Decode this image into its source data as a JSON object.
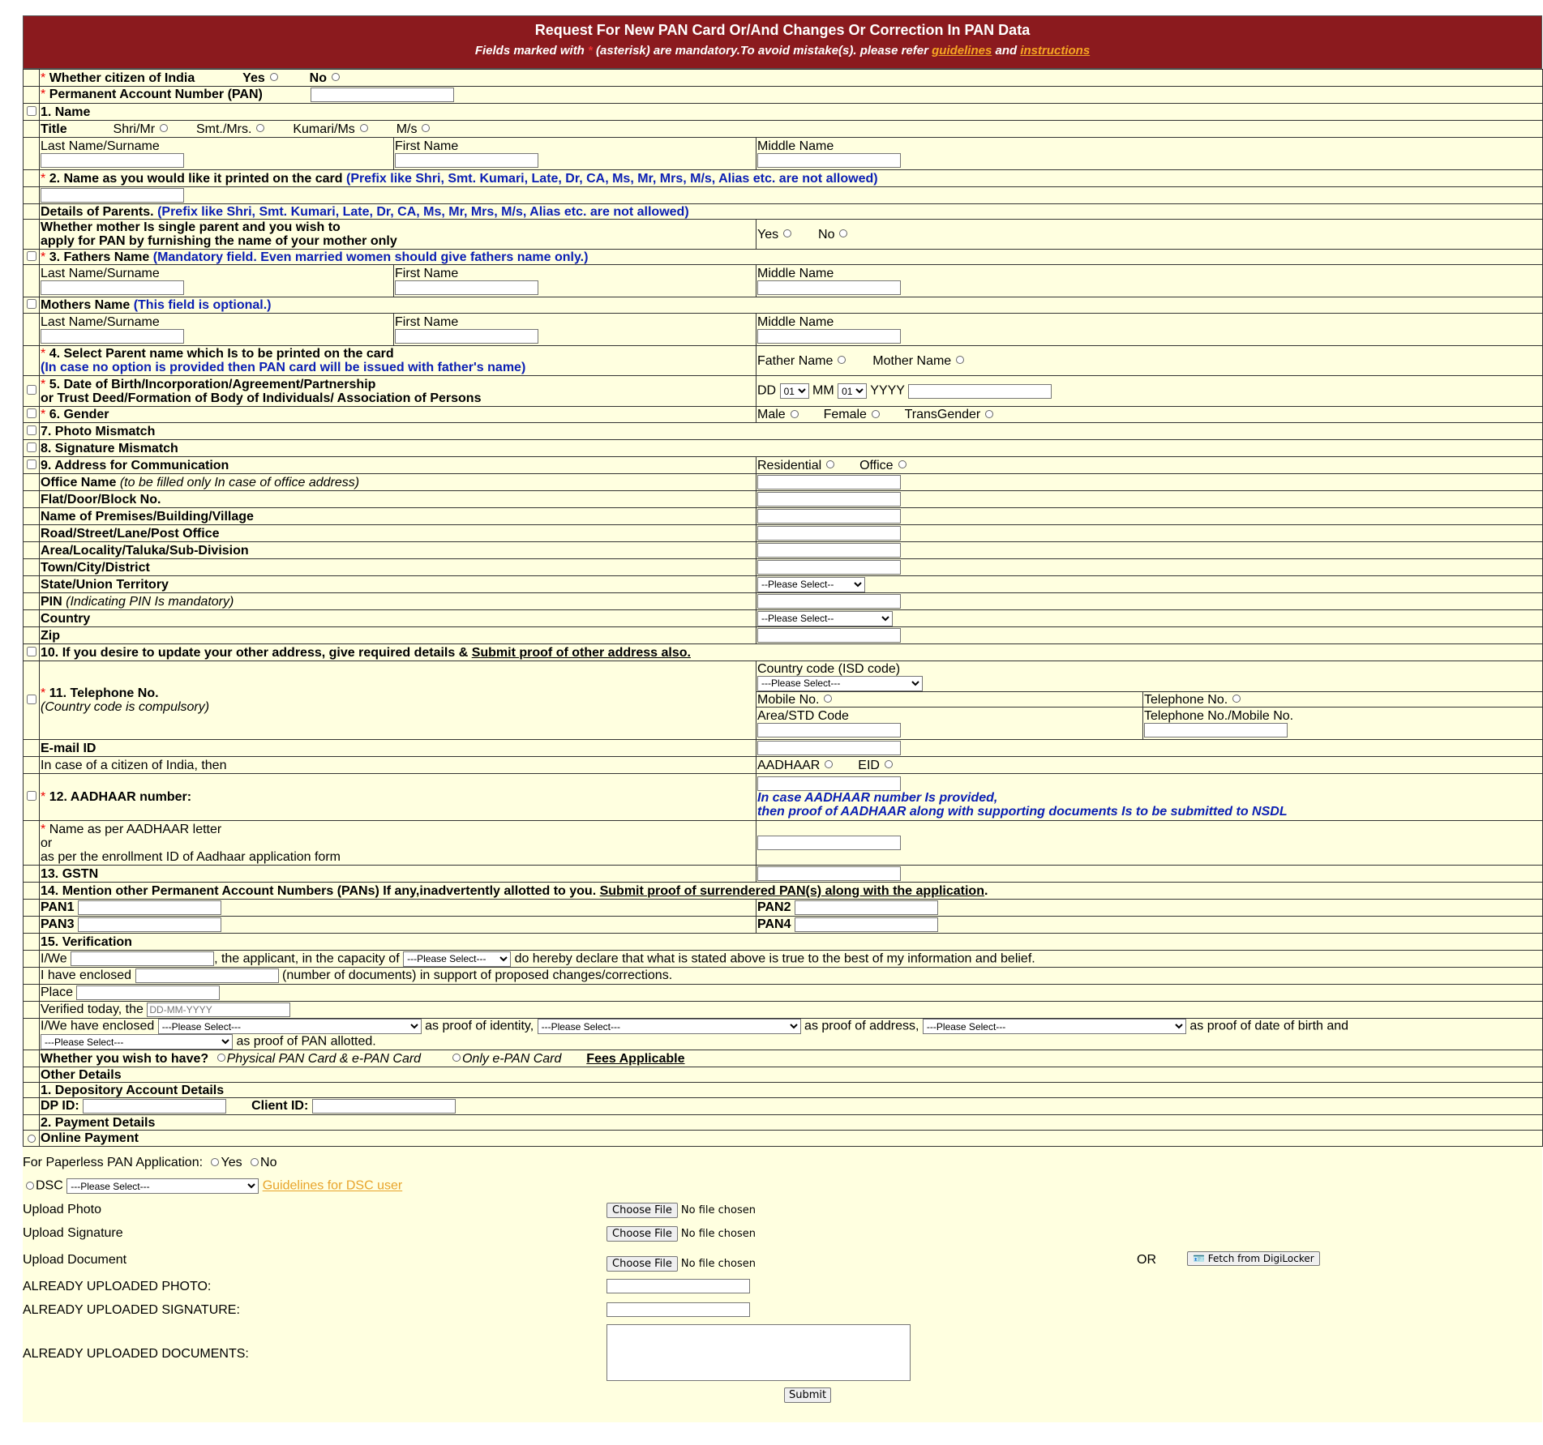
{
  "header": {
    "title": "Request For New PAN Card Or/And Changes Or Correction In PAN Data",
    "sub_a": "Fields marked with",
    "star": "*",
    "sub_b": "(asterisk) are mandatory.To avoid mistake(s). please refer",
    "link_guidelines": "guidelines",
    "and": "and",
    "link_instructions": "instructions"
  },
  "star": "*",
  "citizen": {
    "label": "Whether citizen of India",
    "yes": "Yes",
    "no": "No"
  },
  "pan": {
    "label": "Permanent Account Number (PAN)"
  },
  "name": {
    "heading": "1. Name",
    "title_label": "Title",
    "titles": [
      "Shri/Mr",
      "Smt./Mrs.",
      "Kumari/Ms",
      "M/s"
    ],
    "last": "Last Name/Surname",
    "first": "First Name",
    "middle": "Middle Name"
  },
  "printed": {
    "label": "2. Name as you would like it printed on the card",
    "note": "(Prefix like Shri, Smt. Kumari, Late, Dr, CA, Ms, Mr, Mrs, M/s, Alias etc. are not allowed)"
  },
  "parents": {
    "label": "Details of Parents.",
    "note": "(Prefix like Shri, Smt. Kumari, Late, Dr, CA, Ms, Mr, Mrs, M/s, Alias etc. are not allowed)",
    "single_1": "Whether mother Is single parent and you wish to",
    "single_2": "apply for PAN by furnishing the name of your mother only",
    "yes": "Yes",
    "no": "No"
  },
  "father": {
    "label": "3. Fathers Name",
    "note": "(Mandatory field. Even married women should give fathers name only.)"
  },
  "mother": {
    "label": "Mothers Name",
    "note": "(This field is optional.)"
  },
  "select_parent": {
    "label": "4. Select Parent name which Is to be printed on the card",
    "note": "(In case no option is provided then PAN card will be issued with father's name)",
    "father": "Father Name",
    "mother": "Mother Name"
  },
  "dob": {
    "label1": "5. Date of Birth/Incorporation/Agreement/Partnership",
    "label2": "or Trust Deed/Formation of Body of Individuals/ Association of Persons",
    "dd": "DD",
    "dd_val": "01",
    "mm": "MM",
    "mm_val": "01",
    "yyyy": "YYYY"
  },
  "gender": {
    "label": "6. Gender",
    "male": "Male",
    "female": "Female",
    "trans": "TransGender"
  },
  "photo_mismatch": "7. Photo Mismatch",
  "sign_mismatch": "8. Signature Mismatch",
  "address": {
    "label": "9. Address for Communication",
    "residential": "Residential",
    "office": "Office",
    "office_name": "Office Name",
    "office_name_note": "(to be filled only In case of office address)",
    "flat": "Flat/Door/Block No.",
    "premises": "Name of Premises/Building/Village",
    "road": "Road/Street/Lane/Post Office",
    "area": "Area/Locality/Taluka/Sub-Division",
    "town": "Town/City/District",
    "state": "State/Union Territory",
    "state_select": "--Please Select--",
    "pin": "PIN",
    "pin_note": "(Indicating PIN Is mandatory)",
    "country": "Country",
    "country_select": "--Please Select--",
    "zip": "Zip"
  },
  "other_address": {
    "label": "10. If you desire to update your other address, give required details &",
    "link": "Submit proof of other address also."
  },
  "telephone": {
    "label": "11. Telephone No.",
    "note": "(Country code is compulsory)",
    "isd": "Country code (ISD code)",
    "isd_select": "---Please Select---",
    "mobile": "Mobile No.",
    "telephone": "Telephone No.",
    "area_code": "Area/STD Code",
    "tel_mobile": "Telephone No./Mobile No."
  },
  "email": "E-mail ID",
  "citizen_then": "In case of a citizen of India, then",
  "aadhaar": {
    "aadhaar_opt": "AADHAAR",
    "eid_opt": "EID",
    "label": "12. AADHAAR number:",
    "note1": "In case AADHAAR number Is provided,",
    "note2": "then proof of AADHAAR along with supporting documents Is to be submitted to NSDL",
    "name1": "Name as per AADHAAR letter",
    "name2": "or",
    "name3": "as per the enrollment ID of Aadhaar application form"
  },
  "gstn": "13. GSTN",
  "other_pans": {
    "label": "14. Mention other Permanent Account Numbers (PANs) If any,inadvertently allotted to you.",
    "link": "Submit proof of surrendered PAN(s) along with the application",
    "dot": ".",
    "pan1": "PAN1",
    "pan2": "PAN2",
    "pan3": "PAN3",
    "pan4": "PAN4"
  },
  "verification": {
    "label": "15. Verification",
    "iwe": "I/We",
    "capacity": ", the applicant, in the capacity of",
    "capacity_select": "---Please Select---",
    "declare": "do hereby declare that what is stated above is true to the best of my information and belief.",
    "enclosed": "I have enclosed",
    "enclosed_note": "(number of documents) in support of proposed changes/corrections.",
    "place": "Place",
    "verified": "Verified today, the",
    "date_placeholder": "DD-MM-YYYY",
    "iwe_enclosed": "I/We have enclosed",
    "select": "---Please Select---",
    "identity": "as proof of identity,",
    "address": "as proof of address,",
    "dob": "as proof of date of birth and",
    "pan": "as proof of PAN allotted."
  },
  "card_type": {
    "label": "Whether you wish to have?",
    "physical": "Physical PAN Card & e-PAN Card",
    "epan": "Only e-PAN Card",
    "fees": "Fees Applicable"
  },
  "other_details": "Other Details",
  "depository": "1. Depository Account Details",
  "dp_id": "DP ID:",
  "client_id": "Client ID:",
  "payment": "2. Payment Details",
  "online_payment": "Online Payment",
  "paperless": {
    "label": "For Paperless PAN Application:",
    "yes": "Yes",
    "no": "No"
  },
  "dsc": {
    "label": "DSC",
    "select": "---Please Select---",
    "link": "Guidelines for DSC user"
  },
  "uploads": {
    "photo": "Upload Photo",
    "signature": "Upload Signature",
    "document": "Upload Document",
    "choose": "Choose File",
    "no_file": "No file chosen",
    "or": "OR",
    "digilocker": "Fetch from DigiLocker",
    "already_photo": "ALREADY UPLOADED PHOTO:",
    "already_signature": "ALREADY UPLOADED SIGNATURE:",
    "already_documents": "ALREADY UPLOADED DOCUMENTS:"
  },
  "submit": "Submit"
}
